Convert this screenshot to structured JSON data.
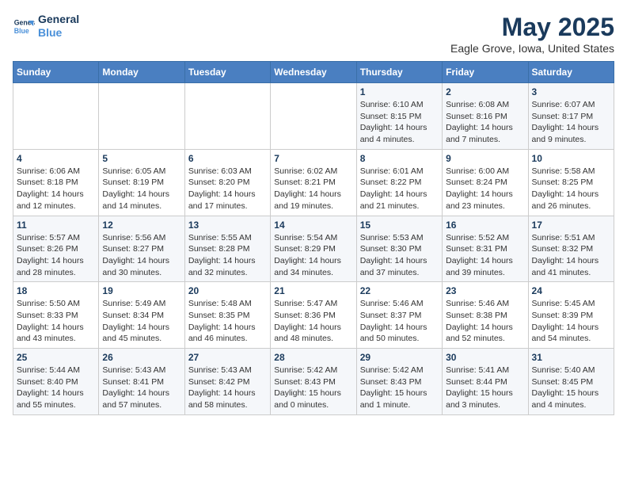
{
  "header": {
    "logo_line1": "General",
    "logo_line2": "Blue",
    "title": "May 2025",
    "subtitle": "Eagle Grove, Iowa, United States"
  },
  "days_of_week": [
    "Sunday",
    "Monday",
    "Tuesday",
    "Wednesday",
    "Thursday",
    "Friday",
    "Saturday"
  ],
  "weeks": [
    [
      {
        "day": "",
        "info": ""
      },
      {
        "day": "",
        "info": ""
      },
      {
        "day": "",
        "info": ""
      },
      {
        "day": "",
        "info": ""
      },
      {
        "day": "1",
        "info": "Sunrise: 6:10 AM\nSunset: 8:15 PM\nDaylight: 14 hours\nand 4 minutes."
      },
      {
        "day": "2",
        "info": "Sunrise: 6:08 AM\nSunset: 8:16 PM\nDaylight: 14 hours\nand 7 minutes."
      },
      {
        "day": "3",
        "info": "Sunrise: 6:07 AM\nSunset: 8:17 PM\nDaylight: 14 hours\nand 9 minutes."
      }
    ],
    [
      {
        "day": "4",
        "info": "Sunrise: 6:06 AM\nSunset: 8:18 PM\nDaylight: 14 hours\nand 12 minutes."
      },
      {
        "day": "5",
        "info": "Sunrise: 6:05 AM\nSunset: 8:19 PM\nDaylight: 14 hours\nand 14 minutes."
      },
      {
        "day": "6",
        "info": "Sunrise: 6:03 AM\nSunset: 8:20 PM\nDaylight: 14 hours\nand 17 minutes."
      },
      {
        "day": "7",
        "info": "Sunrise: 6:02 AM\nSunset: 8:21 PM\nDaylight: 14 hours\nand 19 minutes."
      },
      {
        "day": "8",
        "info": "Sunrise: 6:01 AM\nSunset: 8:22 PM\nDaylight: 14 hours\nand 21 minutes."
      },
      {
        "day": "9",
        "info": "Sunrise: 6:00 AM\nSunset: 8:24 PM\nDaylight: 14 hours\nand 23 minutes."
      },
      {
        "day": "10",
        "info": "Sunrise: 5:58 AM\nSunset: 8:25 PM\nDaylight: 14 hours\nand 26 minutes."
      }
    ],
    [
      {
        "day": "11",
        "info": "Sunrise: 5:57 AM\nSunset: 8:26 PM\nDaylight: 14 hours\nand 28 minutes."
      },
      {
        "day": "12",
        "info": "Sunrise: 5:56 AM\nSunset: 8:27 PM\nDaylight: 14 hours\nand 30 minutes."
      },
      {
        "day": "13",
        "info": "Sunrise: 5:55 AM\nSunset: 8:28 PM\nDaylight: 14 hours\nand 32 minutes."
      },
      {
        "day": "14",
        "info": "Sunrise: 5:54 AM\nSunset: 8:29 PM\nDaylight: 14 hours\nand 34 minutes."
      },
      {
        "day": "15",
        "info": "Sunrise: 5:53 AM\nSunset: 8:30 PM\nDaylight: 14 hours\nand 37 minutes."
      },
      {
        "day": "16",
        "info": "Sunrise: 5:52 AM\nSunset: 8:31 PM\nDaylight: 14 hours\nand 39 minutes."
      },
      {
        "day": "17",
        "info": "Sunrise: 5:51 AM\nSunset: 8:32 PM\nDaylight: 14 hours\nand 41 minutes."
      }
    ],
    [
      {
        "day": "18",
        "info": "Sunrise: 5:50 AM\nSunset: 8:33 PM\nDaylight: 14 hours\nand 43 minutes."
      },
      {
        "day": "19",
        "info": "Sunrise: 5:49 AM\nSunset: 8:34 PM\nDaylight: 14 hours\nand 45 minutes."
      },
      {
        "day": "20",
        "info": "Sunrise: 5:48 AM\nSunset: 8:35 PM\nDaylight: 14 hours\nand 46 minutes."
      },
      {
        "day": "21",
        "info": "Sunrise: 5:47 AM\nSunset: 8:36 PM\nDaylight: 14 hours\nand 48 minutes."
      },
      {
        "day": "22",
        "info": "Sunrise: 5:46 AM\nSunset: 8:37 PM\nDaylight: 14 hours\nand 50 minutes."
      },
      {
        "day": "23",
        "info": "Sunrise: 5:46 AM\nSunset: 8:38 PM\nDaylight: 14 hours\nand 52 minutes."
      },
      {
        "day": "24",
        "info": "Sunrise: 5:45 AM\nSunset: 8:39 PM\nDaylight: 14 hours\nand 54 minutes."
      }
    ],
    [
      {
        "day": "25",
        "info": "Sunrise: 5:44 AM\nSunset: 8:40 PM\nDaylight: 14 hours\nand 55 minutes."
      },
      {
        "day": "26",
        "info": "Sunrise: 5:43 AM\nSunset: 8:41 PM\nDaylight: 14 hours\nand 57 minutes."
      },
      {
        "day": "27",
        "info": "Sunrise: 5:43 AM\nSunset: 8:42 PM\nDaylight: 14 hours\nand 58 minutes."
      },
      {
        "day": "28",
        "info": "Sunrise: 5:42 AM\nSunset: 8:43 PM\nDaylight: 15 hours\nand 0 minutes."
      },
      {
        "day": "29",
        "info": "Sunrise: 5:42 AM\nSunset: 8:43 PM\nDaylight: 15 hours\nand 1 minute."
      },
      {
        "day": "30",
        "info": "Sunrise: 5:41 AM\nSunset: 8:44 PM\nDaylight: 15 hours\nand 3 minutes."
      },
      {
        "day": "31",
        "info": "Sunrise: 5:40 AM\nSunset: 8:45 PM\nDaylight: 15 hours\nand 4 minutes."
      }
    ]
  ]
}
